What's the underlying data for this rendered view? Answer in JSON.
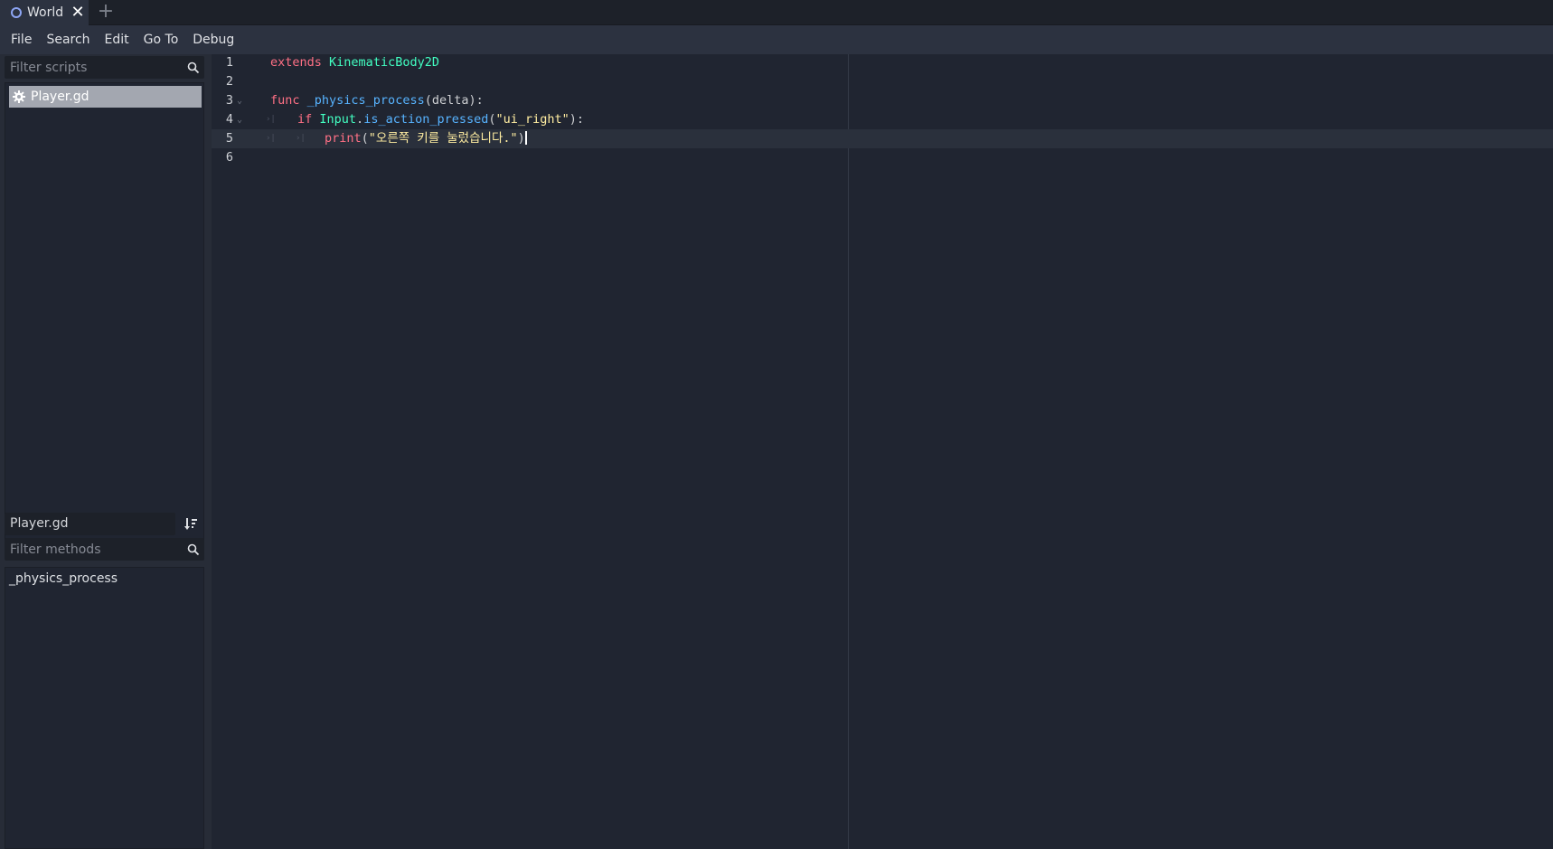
{
  "tabs": [
    {
      "label": "World"
    }
  ],
  "menu": [
    "File",
    "Search",
    "Edit",
    "Go To",
    "Debug"
  ],
  "scripts_panel": {
    "filter_placeholder": "Filter scripts",
    "items": [
      "Player.gd"
    ]
  },
  "methods_panel": {
    "script_name": "Player.gd",
    "filter_placeholder": "Filter methods",
    "items": [
      "_physics_process"
    ]
  },
  "editor": {
    "current_line": 5,
    "lines": [
      {
        "number": "1",
        "tokens": [
          {
            "t": "extends",
            "c": "kw"
          },
          {
            "t": " ",
            "c": "plain"
          },
          {
            "t": "KinematicBody2D",
            "c": "type"
          }
        ]
      },
      {
        "number": "2",
        "tokens": []
      },
      {
        "number": "3",
        "fold": true,
        "tokens": [
          {
            "t": "func",
            "c": "kw"
          },
          {
            "t": " ",
            "c": "plain"
          },
          {
            "t": "_physics_process",
            "c": "fn"
          },
          {
            "t": "(delta):",
            "c": "plain"
          }
        ]
      },
      {
        "number": "4",
        "fold": true,
        "tabs": 1,
        "tokens": [
          {
            "t": "if",
            "c": "kw"
          },
          {
            "t": " ",
            "c": "plain"
          },
          {
            "t": "Input",
            "c": "type"
          },
          {
            "t": ".",
            "c": "plain"
          },
          {
            "t": "is_action_pressed",
            "c": "fn"
          },
          {
            "t": "(",
            "c": "plain"
          },
          {
            "t": "\"ui_right\"",
            "c": "str"
          },
          {
            "t": "):",
            "c": "plain"
          }
        ]
      },
      {
        "number": "5",
        "tabs": 2,
        "tokens": [
          {
            "t": "print",
            "c": "kw"
          },
          {
            "t": "(",
            "c": "plain"
          },
          {
            "t": "\"오른쪽 키를 눌렀습니다.\"",
            "c": "str"
          },
          {
            "t": ")",
            "c": "plain"
          }
        ]
      },
      {
        "number": "6",
        "tokens": []
      }
    ]
  },
  "colors": {
    "background": "#202531",
    "panel": "#272c37",
    "keyword": "#ff7085",
    "type": "#42ffc2",
    "function": "#57b3ff",
    "string": "#ffeda1",
    "accent": "#8da5f3"
  }
}
